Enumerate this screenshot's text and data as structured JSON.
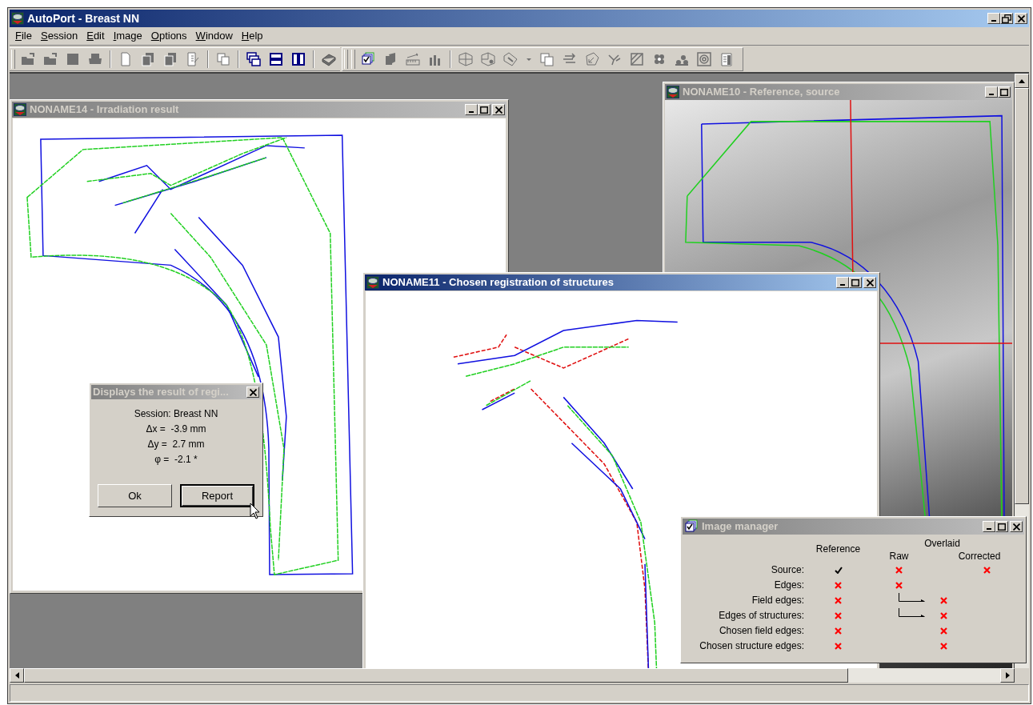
{
  "app": {
    "title": "AutoPort - Breast NN",
    "active": true
  },
  "menu": [
    {
      "label": "File"
    },
    {
      "label": "Session"
    },
    {
      "label": "Edit"
    },
    {
      "label": "Image"
    },
    {
      "label": "Options"
    },
    {
      "label": "Window"
    },
    {
      "label": "Help"
    }
  ],
  "windows": [
    {
      "kind": "drawing",
      "title": "NONAME14 - Irradiation result",
      "active": false
    },
    {
      "kind": "image",
      "title": "NONAME10 - Reference, source",
      "active": false
    },
    {
      "kind": "registration",
      "title": "NONAME11 - Chosen registration of structures",
      "active": true
    }
  ],
  "result_dialog": {
    "title": "Displays the result of regi...",
    "active": false,
    "lines": [
      "Session: Breast NN",
      "Δx =  -3.9 mm",
      "Δy =  2.7 mm",
      "φ =  -2.1 *"
    ],
    "buttons": [
      {
        "label": "Ok",
        "default": false
      },
      {
        "label": "Report",
        "default": true
      }
    ]
  },
  "image_manager": {
    "title": "Image manager",
    "active": false,
    "reference_header": "Reference",
    "overlaid_header": "Overlaid",
    "raw_header": "Raw",
    "corrected_header": "Corrected",
    "rows": [
      {
        "label": "Source:",
        "reference": true,
        "raw": false,
        "corrected": false
      },
      {
        "label": "Edges:",
        "reference": false,
        "raw": false
      },
      {
        "label": "Field edges:",
        "reference": false,
        "branch": true,
        "middle": false
      },
      {
        "label": "Edges of structures:",
        "reference": false,
        "branch": true,
        "middle": false
      },
      {
        "label": "Chosen field edges:",
        "reference": false,
        "middle": false
      },
      {
        "label": "Chosen structure edges:",
        "reference": false,
        "middle": false
      }
    ]
  }
}
